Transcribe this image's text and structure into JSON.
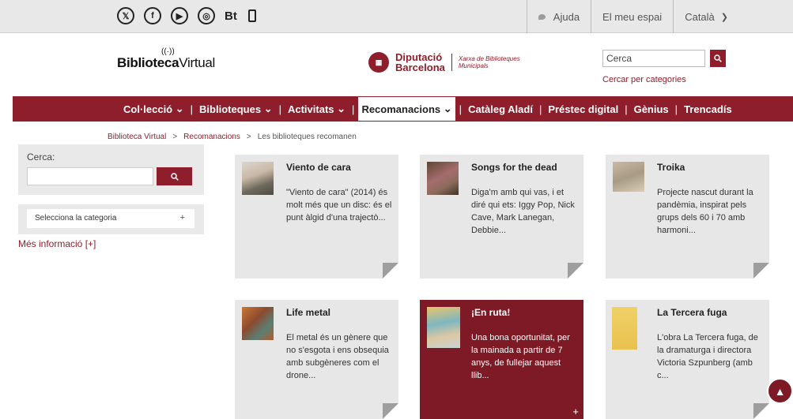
{
  "topbar": {
    "social": [
      {
        "icon": "x-twitter-icon",
        "glyph": "𝕏"
      },
      {
        "icon": "facebook-icon",
        "glyph": "f"
      },
      {
        "icon": "youtube-icon",
        "glyph": "▶"
      },
      {
        "icon": "instagram-icon",
        "glyph": "◎"
      },
      {
        "icon": "bt-icon",
        "glyph": "Bt"
      },
      {
        "icon": "mobile-icon",
        "glyph": ""
      }
    ],
    "help": "Ajuda",
    "my_space": "El meu espai",
    "language": "Català"
  },
  "header": {
    "logo_bold": "Biblioteca",
    "logo_light": "Virtual",
    "dipu_line1": "Diputació",
    "dipu_line2": "Barcelona",
    "dipu_sub1": "Xarxa de Biblioteques",
    "dipu_sub2": "Municipals",
    "search_placeholder": "Cerca",
    "categories_link": "Cercar per categories"
  },
  "nav": {
    "items": [
      {
        "label": "Col·lecció",
        "dropdown": "⌄"
      },
      {
        "label": "Biblioteques",
        "dropdown": "⌄"
      },
      {
        "label": "Activitats",
        "dropdown": "⌄"
      },
      {
        "label": "Recomanacions",
        "dropdown": "⌄"
      },
      {
        "label": "Catàleg Aladí"
      },
      {
        "label": "Préstec digital"
      },
      {
        "label": "Gènius"
      },
      {
        "label": "Trencadís"
      }
    ]
  },
  "breadcrumb": {
    "home": "Biblioteca Virtual",
    "section": "Recomanacions",
    "current": "Les biblioteques recomanen",
    "separator": ">"
  },
  "sidebar": {
    "search_label": "Cerca:",
    "category_select": "Selecciona la categoria",
    "category_plus": "+",
    "more_info": "Més informació [+]"
  },
  "cards": [
    {
      "title": "Viento de cara",
      "text": "\"Viento de cara\" (2014) és molt més que un disc: és el punt àlgid d'una trajectò..."
    },
    {
      "title": "Songs for the dead",
      "text": "Diga'm amb qui vas, i et diré qui ets: Iggy Pop, Nick Cave, Mark Lanegan, Debbie..."
    },
    {
      "title": "Troika",
      "text": "Projecte nascut durant la pandèmia, inspirat pels grups dels 60 i 70 amb harmoni..."
    },
    {
      "title": "Life metal",
      "text": "El metal és un gènere que no s'esgota i ens obsequia amb subgèneres com el drone..."
    },
    {
      "title": "¡En ruta!",
      "text": "Una bona oportunitat, per la mainada a partir de 7 anys, de fullejar aquest llib...",
      "plus": "+"
    },
    {
      "title": "La Tercera fuga",
      "text": "L'obra La Tercera fuga, de la dramaturga i directora Victoria Szpunberg (amb c..."
    }
  ],
  "colors": {
    "brand": "#8e1e2b",
    "card_active": "#7d1a25",
    "card_bg": "#e7e7e7"
  }
}
